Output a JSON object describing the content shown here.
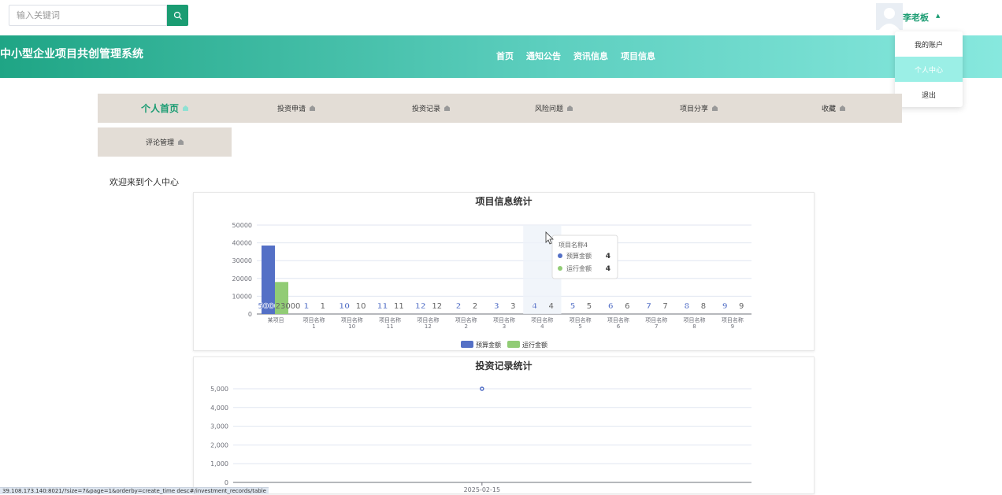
{
  "search": {
    "placeholder": "输入关键词"
  },
  "user": {
    "name": "李老板"
  },
  "site": {
    "title": "中小型企业项目共创管理系统"
  },
  "nav": [
    "首页",
    "通知公告",
    "资讯信息",
    "项目信息"
  ],
  "user_menu": [
    "我的账户",
    "个人中心",
    "退出"
  ],
  "tabs": [
    "个人首页",
    "投资申请",
    "投资记录",
    "风险问题",
    "项目分享",
    "收藏"
  ],
  "subtab": "评论管理",
  "welcome": "欢迎来到个人中心",
  "status_url": "39.108.173.140:8021/?size=7&page=1&orderby=create_time desc#/investment_records/table",
  "colors": {
    "accent": "#1a9c72",
    "budget": "#5470c6",
    "running": "#91cc75"
  },
  "chart_data": [
    {
      "type": "bar",
      "title": "项目信息统计",
      "categories": [
        "某项目",
        "项目名称\n1",
        "项目名称\n10",
        "项目名称\n11",
        "项目名称\n12",
        "项目名称\n2",
        "项目名称\n3",
        "项目名称\n4",
        "项目名称\n5",
        "项目名称\n6",
        "项目名称\n7",
        "项目名称\n8",
        "项目名称\n9"
      ],
      "series": [
        {
          "name": "预算金额",
          "values": [
            38500,
            1,
            10,
            11,
            12,
            2,
            3,
            4,
            5,
            6,
            7,
            8,
            9
          ],
          "labels": [
            "50000",
            "1",
            "10",
            "11",
            "12",
            "2",
            "3",
            "4",
            "5",
            "6",
            "7",
            "8",
            "9"
          ]
        },
        {
          "name": "运行金额",
          "values": [
            18000,
            1,
            10,
            11,
            12,
            2,
            3,
            4,
            5,
            6,
            7,
            8,
            9
          ],
          "labels": [
            "23000",
            "1",
            "10",
            "11",
            "12",
            "2",
            "3",
            "4",
            "5",
            "6",
            "7",
            "8",
            "9"
          ]
        }
      ],
      "yticks": [
        "50000",
        "40000",
        "30000",
        "20000",
        "10000",
        "0"
      ],
      "ylim": [
        0,
        50000
      ],
      "legend": "bottom",
      "tooltip": {
        "title": "项目名称4",
        "rows": [
          {
            "label": "预算金额",
            "value": "4"
          },
          {
            "label": "运行金额",
            "value": "4"
          }
        ]
      }
    },
    {
      "type": "line",
      "title": "投资记录统计",
      "x": [
        "2025-02-15"
      ],
      "y": [
        5000
      ],
      "yticks": [
        "5,000",
        "4,000",
        "3,000",
        "2,000",
        "1,000",
        "0"
      ],
      "ylim": [
        0,
        5000
      ]
    }
  ]
}
